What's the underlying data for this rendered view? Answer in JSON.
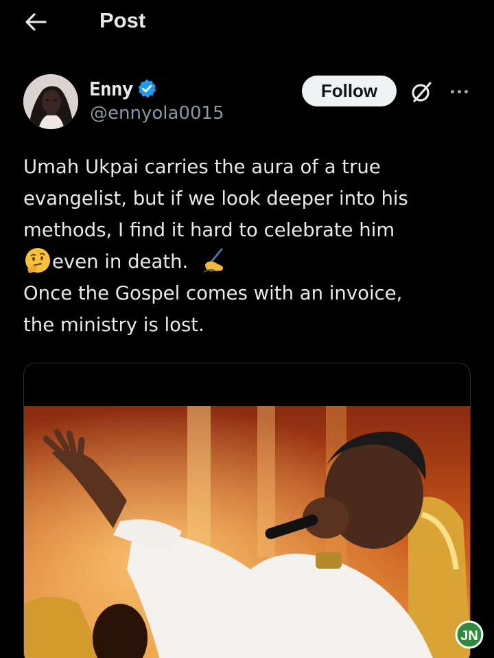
{
  "header": {
    "title": "Post",
    "back_icon": "arrow-left-icon"
  },
  "author": {
    "name": "Enny",
    "handle": "@ennyola0015",
    "verified": true,
    "verified_color": "#1d9bf0"
  },
  "actions": {
    "follow_label": "Follow",
    "grok_icon": "grok-icon",
    "more_icon": "more-horizontal-icon"
  },
  "post": {
    "line1": "Umah Ukpai carries the aura of a true",
    "line2": "evangelist, but if we look deeper into his",
    "line3": "methods, I find it hard to celebrate him",
    "line4": "even in death.",
    "line5": "Once the Gospel comes with an invoice,",
    "line6": "the ministry is lost.",
    "emoji_thinking": "thinking-face-emoji",
    "emoji_writing": "writing-hand-emoji"
  },
  "media": {
    "type": "photo",
    "watermark_text": "JN"
  },
  "colors": {
    "background": "#000000",
    "text": "#e7e9ea",
    "secondary": "#8b98a5",
    "follow_bg": "#eff3f4",
    "accent": "#1d9bf0"
  }
}
